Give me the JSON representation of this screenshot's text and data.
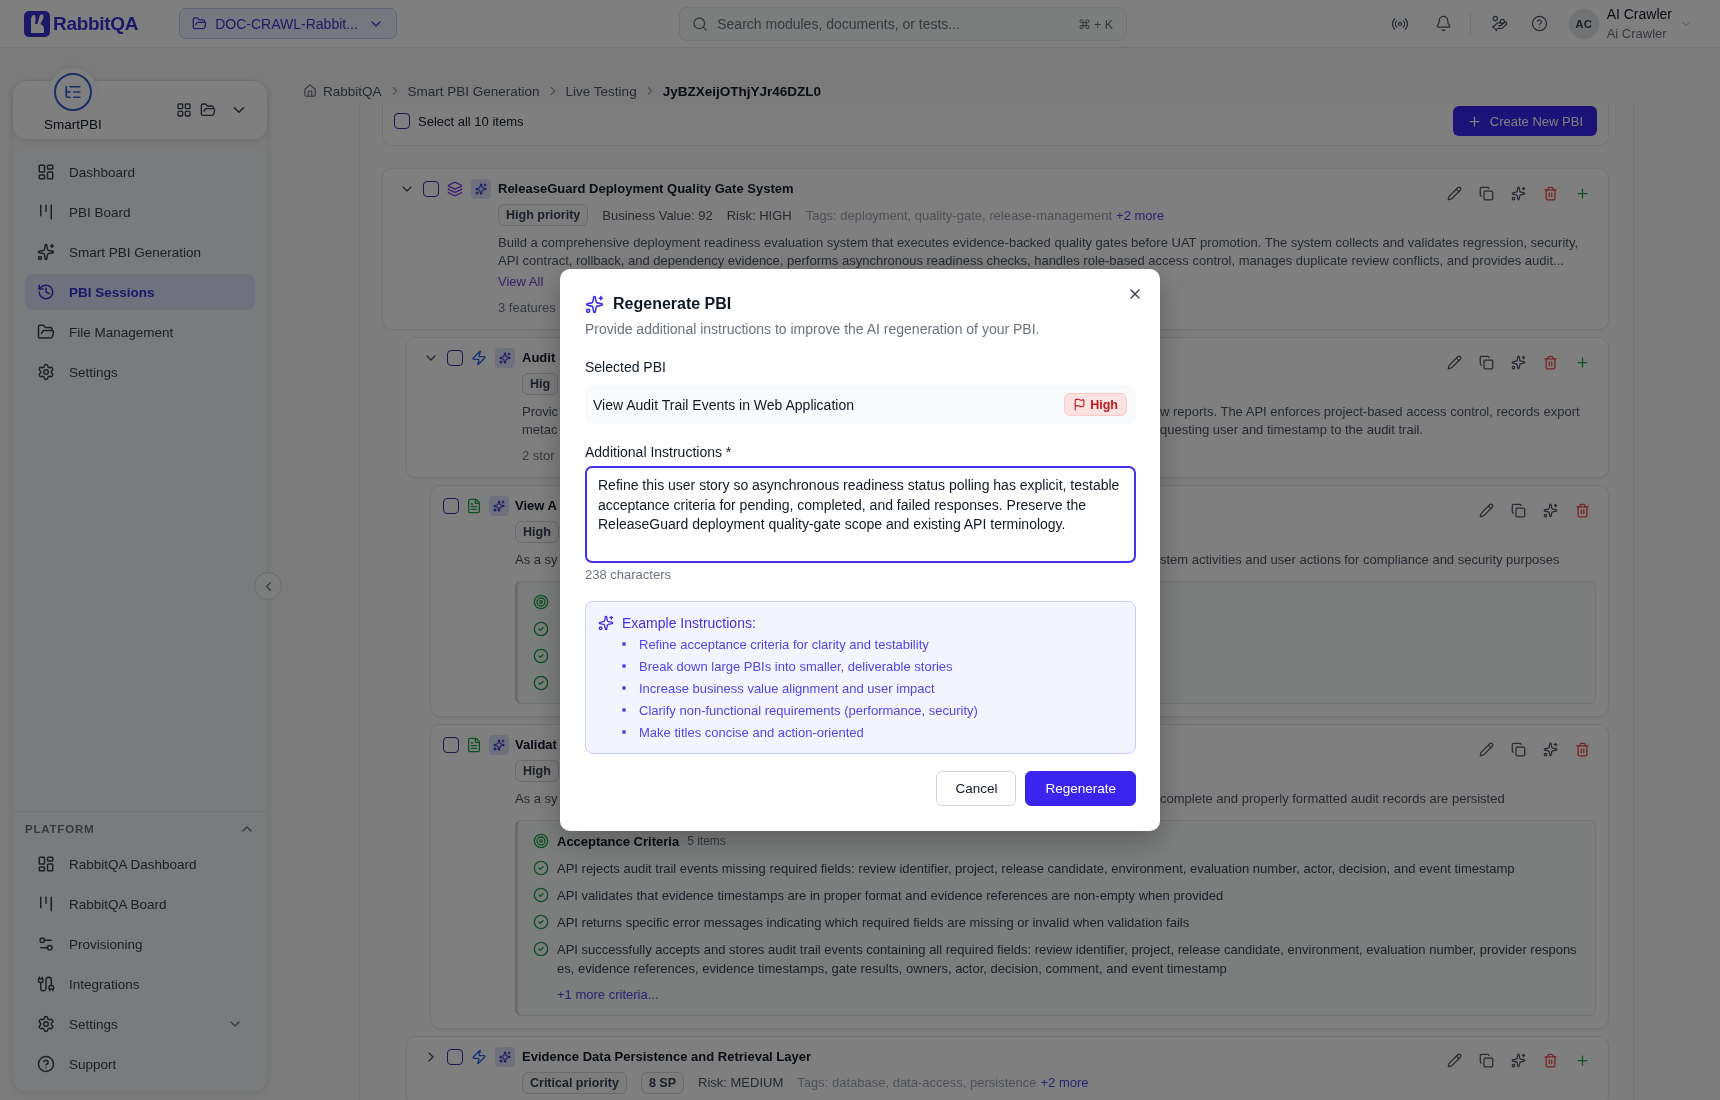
{
  "topbar": {
    "logo": "RabbitQA",
    "project": "DOC-CRAWL-Rabbit...",
    "search": {
      "placeholder": "Search modules, documents, or tests...",
      "shortcut": "⌘ + K"
    },
    "user": {
      "initials": "AC",
      "name": "AI Crawler",
      "role": "Ai Crawler"
    }
  },
  "sidebar": {
    "app": "SmartPBI",
    "nav": [
      {
        "label": "Dashboard",
        "selected": false
      },
      {
        "label": "PBI Board",
        "selected": false
      },
      {
        "label": "Smart PBI Generation",
        "selected": false
      },
      {
        "label": "PBI Sessions",
        "selected": true
      },
      {
        "label": "File Management",
        "selected": false
      },
      {
        "label": "Settings",
        "selected": false
      }
    ],
    "platform": {
      "title": "PLATFORM",
      "expanded": true,
      "items": [
        {
          "label": "RabbitQA Dashboard",
          "kind": "link"
        },
        {
          "label": "RabbitQA Board",
          "kind": "link"
        },
        {
          "label": "Provisioning",
          "kind": "link"
        },
        {
          "label": "Integrations",
          "kind": "link"
        },
        {
          "label": "Settings",
          "kind": "menu",
          "expanded": false
        },
        {
          "label": "Support",
          "kind": "link"
        }
      ]
    }
  },
  "breadcrumb": [
    {
      "label": "RabbitQA",
      "current": false
    },
    {
      "label": "Smart PBI Generation",
      "current": false
    },
    {
      "label": "Live Testing",
      "current": false
    },
    {
      "label": "JyBZXeijOThjYJr46DZL0",
      "current": true
    }
  ],
  "toolbar": {
    "select_all": {
      "label": "Select all 10 items",
      "checked": false
    },
    "create_button": "Create New PBI"
  },
  "pbis": [
    {
      "kind": "epic",
      "expanded": true,
      "checked": false,
      "ai_generated": true,
      "title": "ReleaseGuard Deployment Quality Gate System",
      "badges": [
        "High priority"
      ],
      "meta": [
        "Business Value: 92",
        "Risk: HIGH"
      ],
      "tags": "Tags: deployment, quality-gate, release-management",
      "more_tags": "+2 more",
      "description": "Build a comprehensive deployment readiness evaluation system that executes evidence-backed quality gates before UAT promotion. The system collects and validates regression, security, API contract, rollback, and dependency evidence, performs asynchronous readiness checks, handles role-based access control, manages duplicate review conflicts, and provides audit...",
      "link": "View All",
      "footer": "3 features",
      "children": [
        {
          "kind": "feature",
          "expanded": true,
          "checked": false,
          "ai_generated": true,
          "title": "Audit",
          "badges": [
            "Hig"
          ],
          "description_lines": [
            {
              "left": "Provic",
              "right": "w reports. The API enforces project-based access control, records export"
            },
            {
              "left": "metac",
              "right": "questing user and timestamp to the audit trail."
            }
          ],
          "footer": "2 stor",
          "children": [
            {
              "kind": "story",
              "checked": false,
              "ai_generated": true,
              "title": "View A",
              "badges": [
                "High"
              ],
              "description_lines": [
                {
                  "left": "As a sy",
                  "right": "stem activities and user actions for compliance and security purposes"
                }
              ],
              "criteria": {
                "items": [
                  {
                    "kind": "met"
                  },
                  {
                    "kind": "met"
                  },
                  {
                    "kind": "met"
                  }
                ]
              }
            },
            {
              "kind": "story",
              "checked": false,
              "ai_generated": true,
              "title": "Validat",
              "badges": [
                "High"
              ],
              "description_lines": [
                {
                  "left": "As a sy",
                  "right": "complete and properly formatted audit records are persisted"
                }
              ],
              "criteria": {
                "title": "Acceptance Criteria",
                "count": "5 items",
                "items": [
                  {
                    "kind": "met",
                    "text": "API rejects audit trail events missing required fields: review identifier, project, release candidate, environment, evaluation number, actor, decision, and event timestamp"
                  },
                  {
                    "kind": "met",
                    "text": "API validates that evidence timestamps are in proper format and evidence references are non-empty when provided"
                  },
                  {
                    "kind": "met",
                    "text": "API returns specific error messages indicating which required fields are missing or invalid when validation fails"
                  },
                  {
                    "kind": "met",
                    "text": "API successfully accepts and stores audit trail events containing all required fields: review identifier, project, release candidate, environment, evaluation number, provider responses, evidence references, evidence timestamps, gate results, owners, actor, decision, comment, and event timestamp"
                  }
                ],
                "more": "+1 more criteria..."
              }
            }
          ]
        },
        {
          "kind": "feature",
          "expanded": false,
          "checked": false,
          "ai_generated": true,
          "title": "Evidence Data Persistence and Retrieval Layer",
          "badges": [
            "Critical priority",
            "8 SP"
          ],
          "meta": [
            "Risk: MEDIUM"
          ],
          "tags": "Tags: database, data-access, persistence",
          "more_tags": "+2 more"
        }
      ]
    }
  ],
  "modal": {
    "title": "Regenerate PBI",
    "subtitle": "Provide additional instructions to improve the AI regeneration of your PBI.",
    "selected_label": "Selected PBI",
    "selected_pbi": {
      "title": "View Audit Trail Events in Web Application",
      "priority": "High"
    },
    "instructions": {
      "label": "Additional Instructions *",
      "value": "Refine this user story so asynchronous readiness status polling has explicit, testable acceptance criteria for pending, completed, and failed responses. Preserve the ReleaseGuard deployment quality-gate scope and existing API terminology.",
      "count": "238 characters"
    },
    "examples": {
      "title": "Example Instructions:",
      "items": [
        "Refine acceptance criteria for clarity and testability",
        "Break down large PBIs into smaller, deliverable stories",
        "Increase business value alignment and user impact",
        "Clarify non-functional requirements (performance, security)",
        "Make titles concise and action-oriented"
      ]
    },
    "buttons": [
      {
        "label": "Cancel",
        "kind": "secondary"
      },
      {
        "label": "Regenerate",
        "kind": "primary"
      }
    ]
  }
}
